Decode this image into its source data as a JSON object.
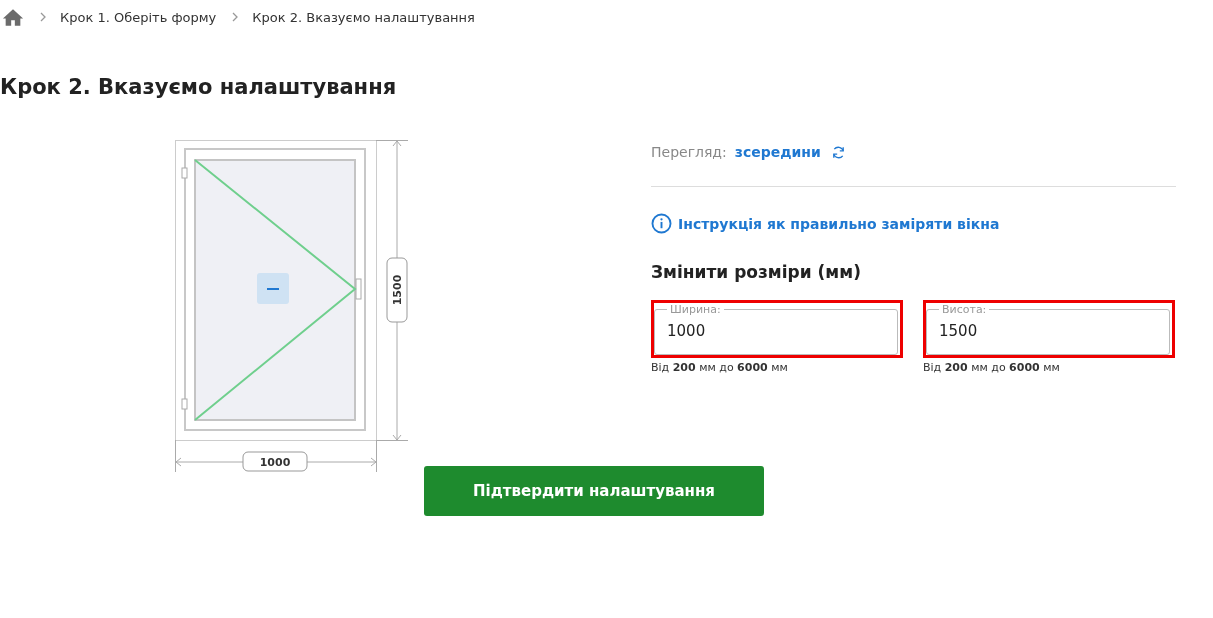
{
  "breadcrumb": [
    {
      "label": "Крок 1. Оберіть форму"
    },
    {
      "label": "Крок 2. Вказуємо налаштування"
    }
  ],
  "title": "Крок 2. Вказуємо налаштування",
  "drawing": {
    "width_label": "1000",
    "height_label": "1500"
  },
  "view": {
    "label": "Перегляд:",
    "value": "зсередини"
  },
  "instruction_link": "Інструкція як правильно заміряти вікна",
  "sizes_heading": "Змінити розміри (мм)",
  "fields": [
    {
      "label": "Ширина:",
      "value": "1000",
      "hint": "Від **200** мм до **6000** мм",
      "highlighted": true
    },
    {
      "label": "Висота:",
      "value": "1500",
      "hint": "Від **200** мм до **6000** мм",
      "highlighted": true
    }
  ],
  "confirm_button": "Підтвердити налаштування"
}
